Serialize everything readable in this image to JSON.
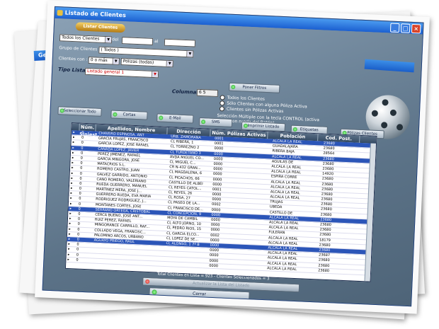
{
  "window": {
    "title": "Listado de Clientes",
    "peek_title": "Gest",
    "min": "_",
    "max": "□",
    "close": "×"
  },
  "top_button": "Listar Clientes",
  "filters": {
    "clients_select": "Todos los Clientes",
    "del_label": "del",
    "al_label": "al",
    "grupo_label": "Grupo de Clientes :",
    "grupo_value": "( Todos )",
    "clientes_con_label": "Clientes con :",
    "clientes_con_value": "0 o más",
    "polizas_value": "Pólizas (todas)",
    "tipo_lista_label": "Tipo Lista:",
    "tipo_lista_value": "Listado general 1",
    "columnas_label": "Columnas:",
    "columnas_value": "6 5"
  },
  "options": {
    "poner_filtros": "Poner Filtros",
    "radios": [
      "Todos los Clientes",
      "Sólo Clientes con alguna Póliza Activa",
      "Clientes sin Pólizas Activas"
    ],
    "multiple_note": "Selección Múltiple con la tecla CONTROL (activa Scroll con rueda del Ratón)"
  },
  "toolbar": {
    "seleccionar_todo": "Seleccionar Todo",
    "cartas": "Cartas",
    "email": "E-Mail",
    "sms": "SMS",
    "imprimir": "Imprimir Listado",
    "etiquetas": "Etiquetas",
    "polizas_clientes": "Pólizas Clientes"
  },
  "table": {
    "headers": [
      "",
      "Núm. Siniest.",
      "Apellidos, Nombre",
      "Dirección",
      "Núm. Pólizas Activas",
      "Población",
      "Cod. Post."
    ],
    "rows": [
      {
        "n": "0",
        "name": "CHAVERO ESPINOSA, ANT",
        "addr": "URB. ZAMORANA",
        "pol": "0001",
        "pob": "ALCALA LA REAL",
        "cp": "23680",
        "hl": true
      },
      {
        "n": "0",
        "name": "GRACIA FRUJAS, FRANCISCO",
        "addr": "CL RIBERA, 1",
        "pol": "0001",
        "pob": "GUADALAJARA",
        "cp": "23680",
        "hl": false
      },
      {
        "n": "0",
        "name": "GARCIA LOPEZ, JOSE RAFAEL",
        "addr": "CL TORREZNO 2",
        "pol": "0000",
        "pob": "RIBERA BAJA",
        "cp": "28564",
        "hl": false
      },
      {
        "n": "0",
        "name": "CAÑADA LOPEZ, JAVIER",
        "addr": "CL TURDETANO 3",
        "pol": "0000",
        "pob": "ALCALA LA REAL",
        "cp": "23680",
        "hl": true
      },
      {
        "n": "0",
        "name": "PEREZ JIMENEZ, RAFAEL",
        "addr": "AVDA MIGUEL CO...",
        "pol": "0000",
        "pob": "AGUILAS DE",
        "cp": "23680",
        "hl": false
      },
      {
        "n": "0",
        "name": "GARCIA MINGORA, JOSE",
        "addr": "CL MIGUEL C...",
        "pol": "0000",
        "pob": "ALCALA LA REAL",
        "cp": "23680",
        "hl": false
      },
      {
        "n": "0",
        "name": "MATACRIOS S.L.",
        "addr": "CR N-432 GRAN...",
        "pol": "0000",
        "pob": "ALCALA LA REAL",
        "cp": "14920",
        "hl": false
      },
      {
        "n": "0",
        "name": "ROMERO CASTRO, JUAN",
        "addr": "CL MAGDALENA, 6",
        "pol": "0000",
        "pob": "ESPIRA CORRE",
        "cp": "23680",
        "hl": false
      },
      {
        "n": "0",
        "name": "GALVEZ GARRIDO, ANTONIO",
        "addr": "CL PICACHOS, 66",
        "pol": "0000",
        "pob": "ALCALA LA REAL",
        "cp": "23680",
        "hl": false
      },
      {
        "n": "0",
        "name": "CANO ROMERO, VALERIANO",
        "addr": "CASTILLO DE ALBEI",
        "pol": "0000",
        "pob": "ALCALA LA REAL",
        "cp": "23680",
        "hl": false
      },
      {
        "n": "0",
        "name": "RUEDA GUERRERO, MANUEL",
        "addr": "CL REYES CATOL...",
        "pol": "0001",
        "pob": "ALCALA LA REAL",
        "cp": "23680",
        "hl": false
      },
      {
        "n": "0",
        "name": "MARTINEZ MERA, JOSE J...",
        "addr": "CL REYES, 26",
        "pol": "0000",
        "pob": "ALCALA LA REAL",
        "cp": "23680",
        "hl": false
      },
      {
        "n": "0",
        "name": "GUERRERO RUEDA, EVA MARIA",
        "addr": "CL ROSA, 27",
        "pol": "0000",
        "pob": "TRUJAS",
        "cp": "23680",
        "hl": false
      },
      {
        "n": "0",
        "name": "RODRIGUEZ RODRIGUEZ, J...",
        "addr": "CL PASEO DE LA...",
        "pol": "0002",
        "pob": "UBEDA",
        "cp": "23680",
        "hl": false
      },
      {
        "n": "0",
        "name": "MONTAÑES CORTES, JOSE",
        "addr": "CL FRANCISCO DE...",
        "pol": "0000",
        "pob": "CASTILLO DE",
        "cp": "23680",
        "hl": false
      },
      {
        "n": "0",
        "name": "SERRANO ORTEGA, CRISTOBAL",
        "addr": "CL CONCEPCION, 9",
        "pol": "0000",
        "pob": "ALCALA LA REAL",
        "cp": "23680",
        "hl": true
      },
      {
        "n": "0",
        "name": "CERCA BUENO, JOSE ANT...",
        "addr": "MOYA DE CAMBIL",
        "pol": "0000",
        "pob": "ALCALA LA REAL",
        "cp": "23680",
        "hl": false
      },
      {
        "n": "0",
        "name": "RUIZ PEREZ, RAFAEL",
        "addr": "CL ALTO JORNO, 10",
        "pol": "0000",
        "pob": "ALCALA LA REAL",
        "cp": "23680",
        "hl": false
      },
      {
        "n": "0",
        "name": "MINGORANCE CARRILLO, RAF...",
        "addr": "CL PEDRO RIOS, 15",
        "pol": "0000",
        "pob": "FULERAN",
        "cp": "23680",
        "hl": false
      },
      {
        "n": "0",
        "name": "COLLADO VEGA, FRANCISC...",
        "addr": "CL GARCIA ELCO...",
        "pol": "0002",
        "pob": "ALCALA LA REAL",
        "cp": "18179",
        "hl": false
      },
      {
        "n": "0",
        "name": "PALOMINO ARCOS, URBANO",
        "addr": "CL LOPEZ DE SE...",
        "pol": "0000",
        "pob": "ALCALA LA REAL",
        "cp": "23680",
        "hl": false
      },
      {
        "n": "0",
        "name": "AGUAYO PRIEGO, RAUL",
        "addr": "CL ALONSO, 1 7º B",
        "pol": "0000",
        "pob": "ALCALA LA REAL",
        "cp": "23680",
        "hl": true
      },
      {
        "n": "0",
        "name": "",
        "addr": "",
        "pol": "0000",
        "pob": "ALCALA LA REAL",
        "cp": "23687",
        "hl": false
      },
      {
        "n": "0",
        "name": "",
        "addr": "",
        "pol": "0000",
        "pob": "ALCALA LA REAL",
        "cp": "23680",
        "hl": false
      },
      {
        "n": "0",
        "name": "",
        "addr": "",
        "pol": "0000",
        "pob": "ALCALA LA REAL",
        "cp": "23680",
        "hl": false
      },
      {
        "n": "0",
        "name": "",
        "addr": "",
        "pol": "0000",
        "pob": "ALCALA LA REAL",
        "cp": "23680",
        "hl": false
      }
    ]
  },
  "status": "Total Clientes en Lista = 923 - Clientes Seleccionados = 3",
  "desel_button": "Actualizar la Lista del Listado",
  "close_button": "Cerrar"
}
